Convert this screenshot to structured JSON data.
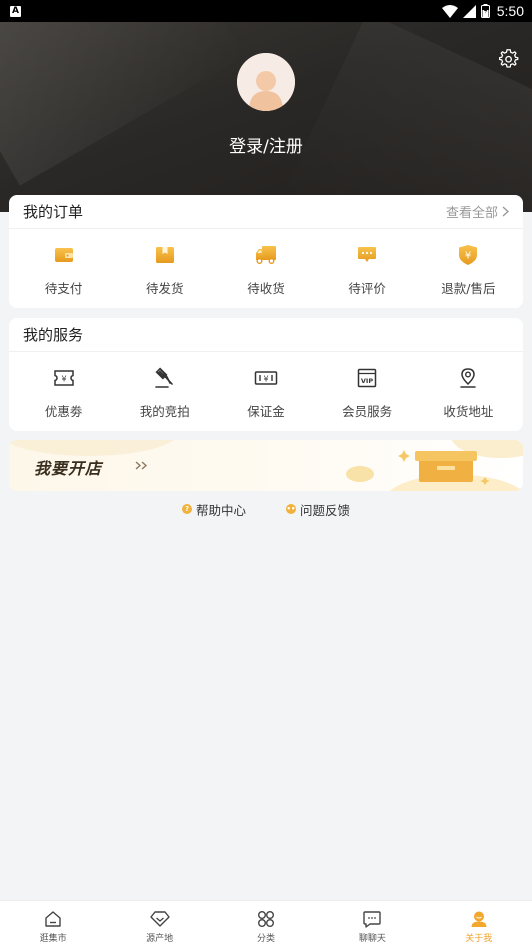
{
  "status_bar": {
    "time": "5:50",
    "app_badge": "A"
  },
  "header": {
    "login_label": "登录/注册"
  },
  "orders": {
    "title": "我的订单",
    "view_all": "查看全部",
    "items": [
      {
        "label": "待支付",
        "icon": "wallet-icon"
      },
      {
        "label": "待发货",
        "icon": "package-icon"
      },
      {
        "label": "待收货",
        "icon": "truck-icon"
      },
      {
        "label": "待评价",
        "icon": "comment-icon"
      },
      {
        "label": "退款/售后",
        "icon": "refund-shield-icon"
      }
    ]
  },
  "services": {
    "title": "我的服务",
    "items": [
      {
        "label": "优惠劵",
        "icon": "coupon-icon"
      },
      {
        "label": "我的竞拍",
        "icon": "auction-hammer-icon"
      },
      {
        "label": "保证金",
        "icon": "deposit-icon"
      },
      {
        "label": "会员服务",
        "icon": "vip-icon"
      },
      {
        "label": "收货地址",
        "icon": "location-icon"
      }
    ]
  },
  "banner": {
    "text": "我要开店"
  },
  "links": [
    {
      "label": "帮助中心",
      "icon": "help-icon"
    },
    {
      "label": "问题反馈",
      "icon": "feedback-icon"
    }
  ],
  "bottom_nav": [
    {
      "label": "逛集市",
      "icon": "home-icon"
    },
    {
      "label": "源产地",
      "icon": "diamond-icon"
    },
    {
      "label": "分类",
      "icon": "category-icon"
    },
    {
      "label": "聊聊天",
      "icon": "chat-icon"
    },
    {
      "label": "关于我",
      "icon": "profile-icon",
      "active": true
    }
  ],
  "colors": {
    "accent": "#f0a12a",
    "header_dark": "#2a2826",
    "page_bg": "#f3f4f6"
  }
}
